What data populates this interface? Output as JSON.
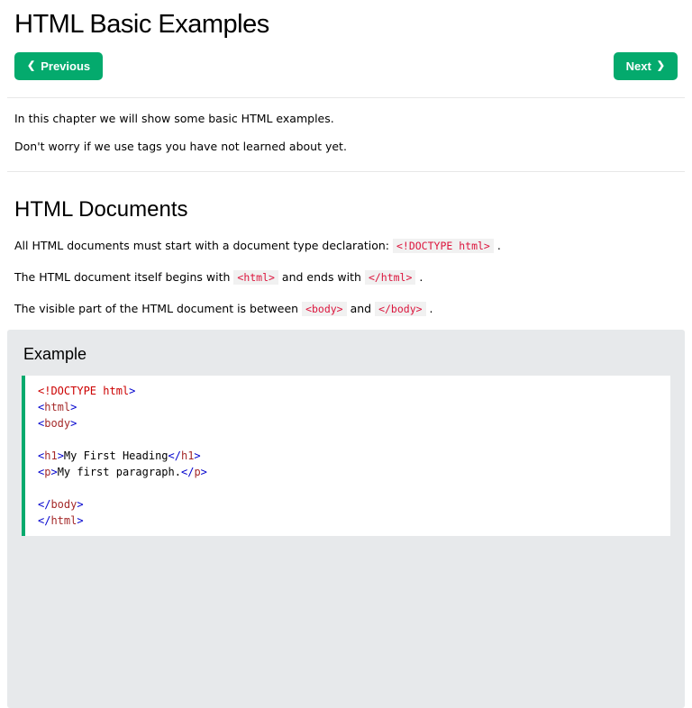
{
  "colors": {
    "green": "#04AA6D",
    "tag": "#0000CD",
    "tagname": "#A52A2A",
    "doctype": "#CC0000",
    "text": "#000000",
    "codespan_text": "#DC143C",
    "codespan_bg": "#f1f1f1",
    "panel_bg": "#E7E9EB"
  },
  "header": {
    "title": "HTML Basic Examples"
  },
  "nav": {
    "previous": {
      "chevron": "❮",
      "label": "Previous"
    },
    "next": {
      "label": "Next",
      "chevron": "❯"
    }
  },
  "intro": {
    "p1": "In this chapter we will show some basic HTML examples.",
    "p2": "Don't worry if we use tags you have not learned about yet."
  },
  "documents_section": {
    "heading": "HTML Documents",
    "paragraphs": [
      [
        {
          "text": "All HTML documents must start with a document type declaration: "
        },
        {
          "text": "<!DOCTYPE html>",
          "code": true
        },
        {
          "text": " ."
        }
      ],
      [
        {
          "text": "The HTML document itself begins with "
        },
        {
          "text": "<html>",
          "code": true
        },
        {
          "text": " and ends with "
        },
        {
          "text": "</html>",
          "code": true
        },
        {
          "text": " ."
        }
      ],
      [
        {
          "text": "The visible part of the HTML document is between "
        },
        {
          "text": "<body>",
          "code": true
        },
        {
          "text": " and "
        },
        {
          "text": "</body>",
          "code": true
        },
        {
          "text": " ."
        }
      ]
    ]
  },
  "example": {
    "heading": "Example",
    "code_lines": [
      [
        {
          "t": "<!DOCTYPE html",
          "c": "doctype"
        },
        {
          "t": ">",
          "c": "tag"
        }
      ],
      [
        {
          "t": "<",
          "c": "tag"
        },
        {
          "t": "html",
          "c": "tagname"
        },
        {
          "t": ">",
          "c": "tag"
        }
      ],
      [
        {
          "t": "<",
          "c": "tag"
        },
        {
          "t": "body",
          "c": "tagname"
        },
        {
          "t": ">",
          "c": "tag"
        }
      ],
      [],
      [
        {
          "t": "<",
          "c": "tag"
        },
        {
          "t": "h1",
          "c": "tagname"
        },
        {
          "t": ">",
          "c": "tag"
        },
        {
          "t": "My First Heading",
          "c": "text"
        },
        {
          "t": "</",
          "c": "tag"
        },
        {
          "t": "h1",
          "c": "tagname"
        },
        {
          "t": ">",
          "c": "tag"
        }
      ],
      [
        {
          "t": "<",
          "c": "tag"
        },
        {
          "t": "p",
          "c": "tagname"
        },
        {
          "t": ">",
          "c": "tag"
        },
        {
          "t": "My first paragraph.",
          "c": "text"
        },
        {
          "t": "</",
          "c": "tag"
        },
        {
          "t": "p",
          "c": "tagname"
        },
        {
          "t": ">",
          "c": "tag"
        }
      ],
      [],
      [
        {
          "t": "</",
          "c": "tag"
        },
        {
          "t": "body",
          "c": "tagname"
        },
        {
          "t": ">",
          "c": "tag"
        }
      ],
      [
        {
          "t": "</",
          "c": "tag"
        },
        {
          "t": "html",
          "c": "tagname"
        },
        {
          "t": ">",
          "c": "tag"
        }
      ]
    ]
  }
}
